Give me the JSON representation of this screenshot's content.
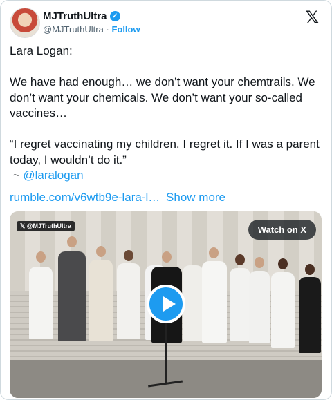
{
  "author": {
    "display_name": "MJTruthUltra",
    "handle": "@MJTruthUltra",
    "separator": "·",
    "follow_label": "Follow",
    "verified_glyph": "✓"
  },
  "platform_logo": "𝕏",
  "tweet": {
    "line1": "Lara Logan:",
    "paragraph1": "We have had enough… we don’t want your chemtrails. We don’t want your chemicals. We don’t want your so-called vaccines…",
    "quote": "“I regret vaccinating my children. I regret it. If I was a parent today, I wouldn’t do it.”",
    "attribution_prefix": " ~ ",
    "mention": "@laralogan",
    "link": "rumble.com/v6wtb9e-lara-l…",
    "show_more": "Show more"
  },
  "media": {
    "watermark": "𝕏 @MJTruthUltra",
    "watch_label": "Watch on X",
    "play_icon": "play-icon"
  },
  "colors": {
    "accent": "#1d9bf0",
    "text": "#0f1419",
    "secondary": "#536471",
    "border": "#cfd9de"
  }
}
